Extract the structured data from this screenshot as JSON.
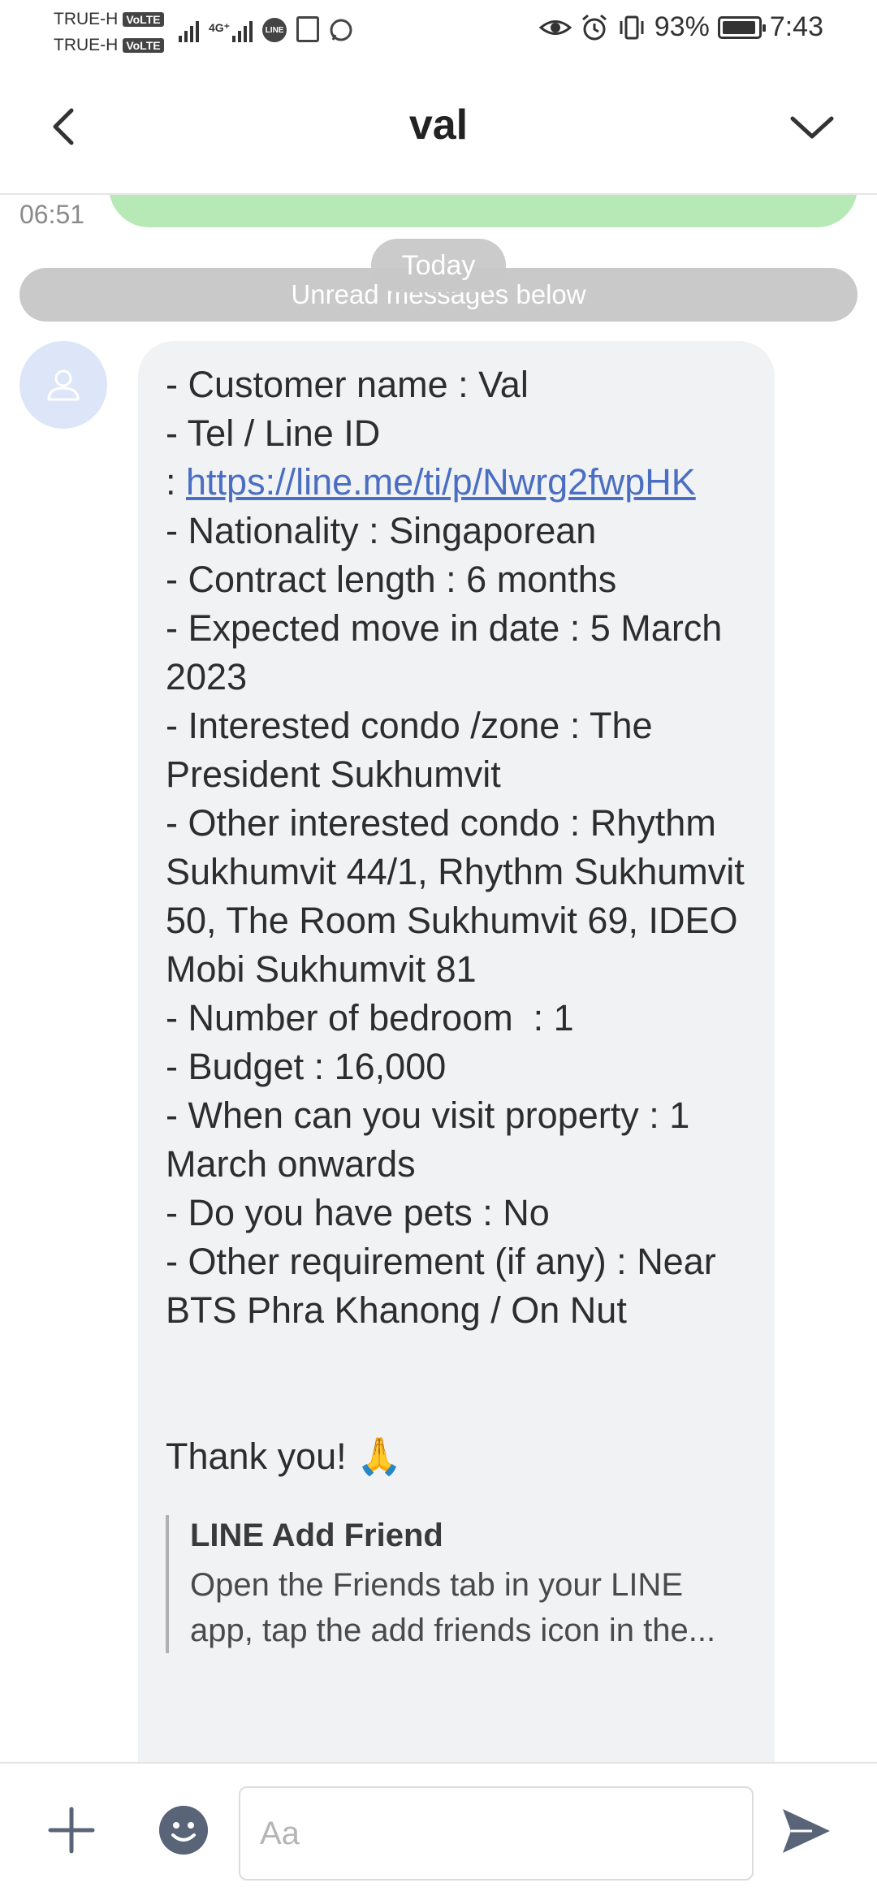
{
  "status_bar": {
    "carrier_1": "TRUE-H",
    "carrier_2": "TRUE-H",
    "volte_badge": "VoLTE",
    "network_type": "4G⁺",
    "battery_percent": "93%",
    "time": "7:43",
    "icons": [
      "eye-icon",
      "alarm-icon",
      "vibrate-icon",
      "battery-icon",
      "line-app-icon",
      "seven-eleven-icon",
      "whatsapp-icon"
    ]
  },
  "header": {
    "title": "val"
  },
  "chat": {
    "previous_message_time": "06:51",
    "date_separator": "Today",
    "unread_notice": "Unread messages below",
    "message": {
      "lines": {
        "l1": "- Customer name : Val",
        "l2": "- Tel / Line ID",
        "l3_prefix": ": ",
        "link": "https://line.me/ti/p/Nwrg2fwpHK",
        "l4": "- Nationality : Singaporean",
        "l5": "- Contract length : 6 months",
        "l6": "- Expected move in date : 5 March 2023",
        "l7": "- Interested condo /zone : The President Sukhumvit",
        "l8": "- Other interested condo : Rhythm Sukhumvit 44/1, Rhythm Sukhumvit 50, The Room Sukhumvit 69, IDEO Mobi Sukhumvit 81",
        "l9": "- Number of bedroom  : 1",
        "l10": "- Budget : 16,000",
        "l11": "- When can you visit property : 1 March onwards",
        "l12": "- Do you have pets : No",
        "l13": "- Other requirement (if any) : Near BTS Phra Khanong / On Nut"
      },
      "thanks": "Thank you! 🙏",
      "link_preview": {
        "title": "LINE Add Friend",
        "description": "Open the Friends tab in your LINE app, tap the add friends icon in the..."
      }
    }
  },
  "input_bar": {
    "placeholder": "Aa"
  },
  "colors": {
    "sent_bubble": "#b6e9b6",
    "received_bubble": "#f1f2f4",
    "link": "#4a6fc2",
    "unread_bar": "#c9c9c9"
  }
}
